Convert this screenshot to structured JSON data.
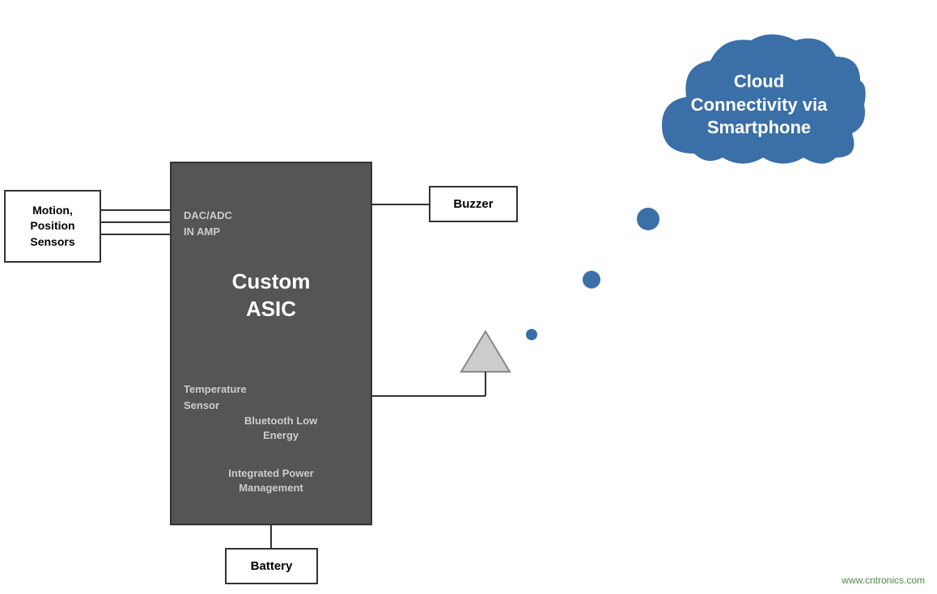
{
  "cloud": {
    "text": "Cloud\nConnectivity via\nSmartphone",
    "line1": "Cloud",
    "line2": "Connectivity via",
    "line3": "Smartphone",
    "color": "#3a6fa8"
  },
  "asic": {
    "title_line1": "Custom",
    "title_line2": "ASIC",
    "dac_label": "DAC/ADC\nIN AMP",
    "dac_line1": "DAC/ADC",
    "dac_line2": "IN AMP",
    "temp_label": "Temperature\nSensor",
    "temp_line1": "Temperature",
    "temp_line2": "Sensor",
    "ble_label": "Bluetooth Low\nEnergy",
    "ble_line1": "Bluetooth Low",
    "ble_line2": "Energy",
    "power_label": "Integrated Power\nManagement",
    "power_line1": "Integrated Power",
    "power_line2": "Management"
  },
  "sensors": {
    "label": "Motion,\nPosition\nSensors",
    "line1": "Motion,",
    "line2": "Position",
    "line3": "Sensors"
  },
  "buzzer": {
    "label": "Buzzer"
  },
  "battery": {
    "label": "Battery"
  },
  "watermark": {
    "text": "www.cntronics.com"
  }
}
